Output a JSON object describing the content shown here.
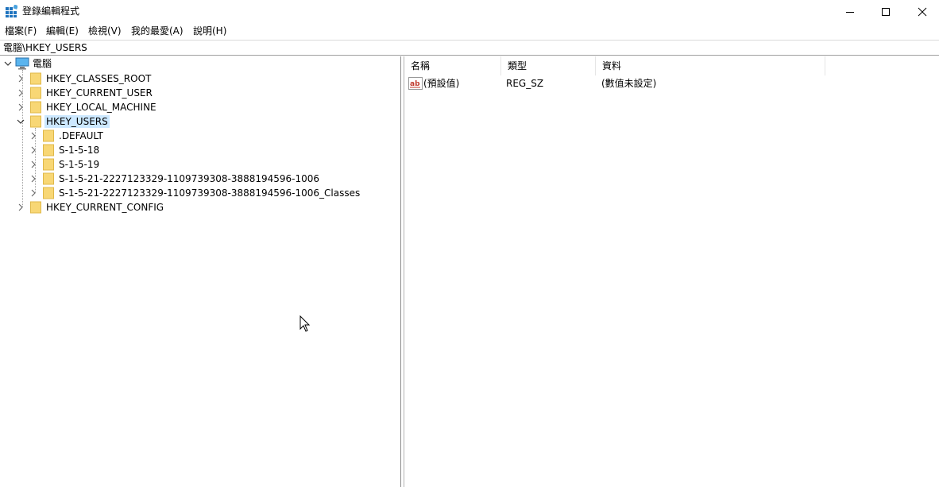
{
  "window": {
    "title": "登錄編輯程式"
  },
  "menu": [
    "檔案(F)",
    "編輯(E)",
    "檢視(V)",
    "我的最愛(A)",
    "說明(H)"
  ],
  "address": "電腦\\HKEY_USERS",
  "tree": {
    "root": "電腦",
    "hives": [
      "HKEY_CLASSES_ROOT",
      "HKEY_CURRENT_USER",
      "HKEY_LOCAL_MACHINE",
      "HKEY_USERS",
      "HKEY_CURRENT_CONFIG"
    ],
    "selected": "HKEY_USERS",
    "users_children": [
      ".DEFAULT",
      "S-1-5-18",
      "S-1-5-19",
      "S-1-5-21-2227123329-1109739308-3888194596-1006",
      "S-1-5-21-2227123329-1109739308-3888194596-1006_Classes"
    ]
  },
  "list": {
    "columns": [
      "名稱",
      "類型",
      "資料"
    ],
    "rows": [
      {
        "name": "(預設值)",
        "type": "REG_SZ",
        "data": "(數值未設定)",
        "icon": "string-value-icon"
      }
    ]
  }
}
